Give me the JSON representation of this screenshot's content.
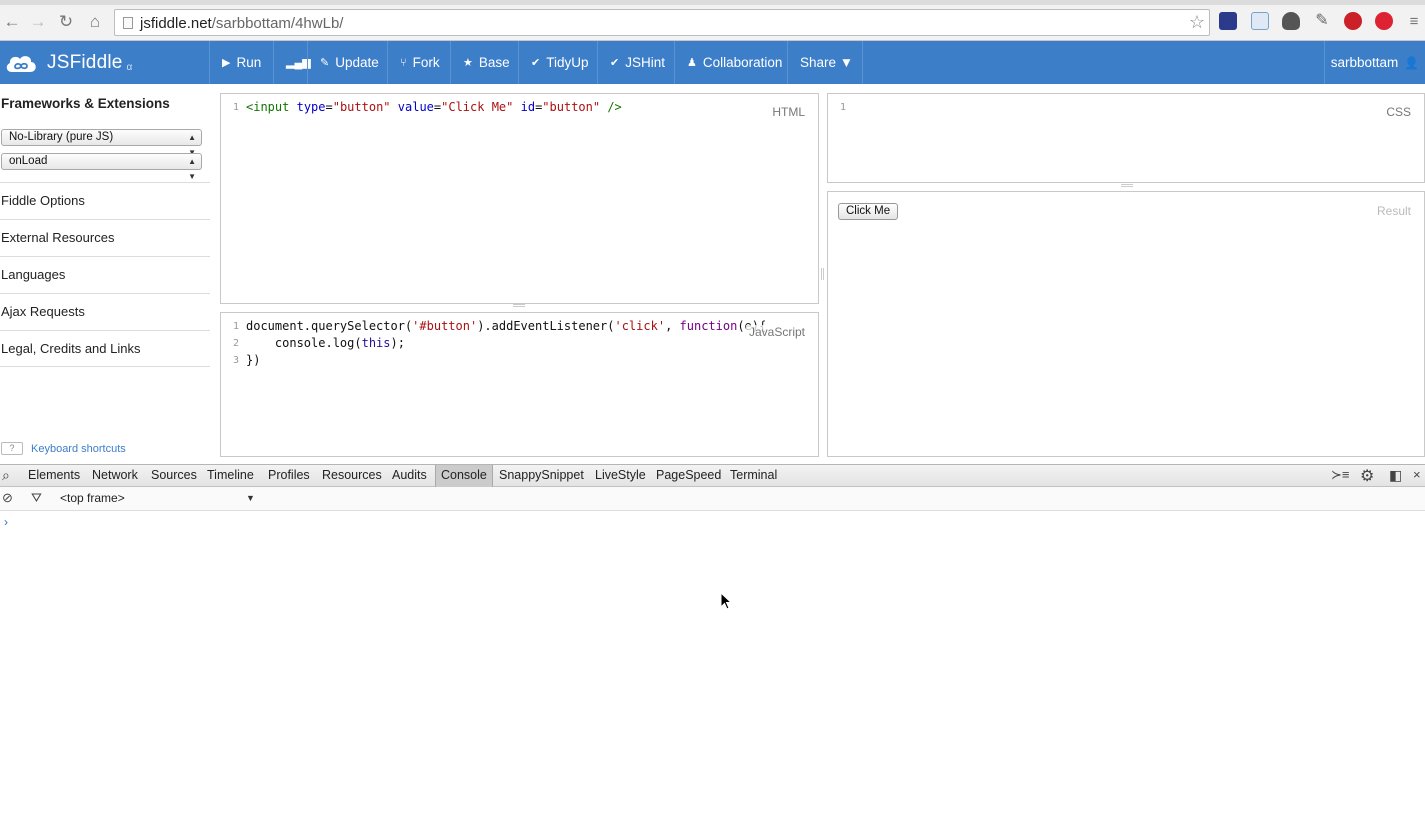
{
  "browser": {
    "url_host": "jsfiddle.net",
    "url_path": "/sarbbottam/4hwLb/"
  },
  "header": {
    "brand": "JSFiddle",
    "beta": "α",
    "buttons": [
      {
        "label": "Run",
        "icon": "▶"
      },
      {
        "label": "",
        "icon": "▮"
      },
      {
        "label": "Update",
        "icon": "✎"
      },
      {
        "label": "Fork",
        "icon": "⑂"
      },
      {
        "label": "Base",
        "icon": "★"
      },
      {
        "label": "TidyUp",
        "icon": "✔"
      },
      {
        "label": "JSHint",
        "icon": "✔"
      },
      {
        "label": "Collaboration",
        "icon": "👥"
      },
      {
        "label": "Share ▼",
        "icon": ""
      }
    ],
    "user": "sarbbottam"
  },
  "sidebar": {
    "title": "Frameworks & Extensions",
    "library_select": "No-Library (pure JS)",
    "load_select": "onLoad",
    "items": [
      "Fiddle Options",
      "External Resources",
      "Languages",
      "Ajax Requests",
      "Legal, Credits and Links"
    ],
    "kbd_box": "?",
    "kbd_label": "Keyboard shortcuts"
  },
  "panels": {
    "html_label": "HTML",
    "css_label": "CSS",
    "js_label": "JavaScript",
    "result_label": "Result",
    "result_button": "Click Me"
  },
  "devtools": {
    "tabs": [
      "Elements",
      "Network",
      "Sources",
      "Timeline",
      "Profiles",
      "Resources",
      "Audits",
      "Console",
      "SnappySnippet",
      "LiveStyle",
      "PageSpeed",
      "Terminal"
    ],
    "active_tab": "Console",
    "frame": "<top frame>",
    "prompt": "›"
  }
}
